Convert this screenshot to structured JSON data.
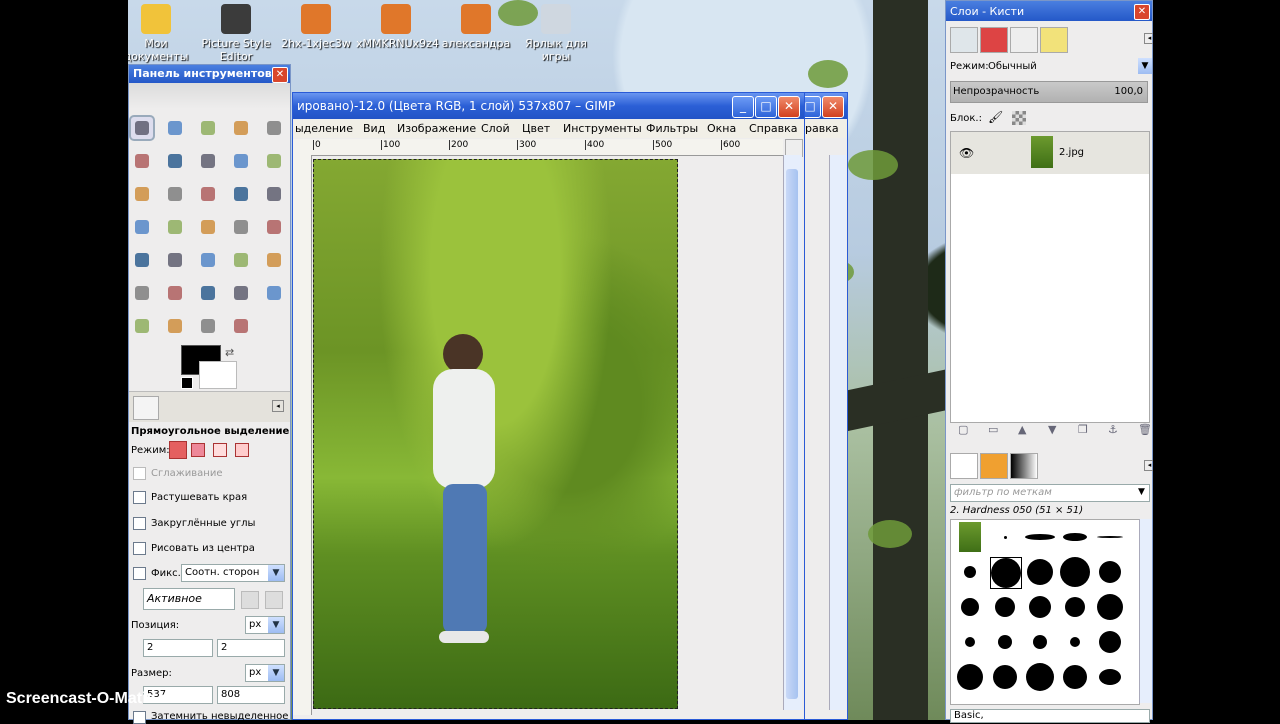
{
  "desktop": {
    "icons": [
      {
        "label": "Мои документы",
        "color": "#f1c33a"
      },
      {
        "label": "Picture Style Editor",
        "color": "#3b3b3b"
      },
      {
        "label": "2hx-1xjec3w",
        "color": "#e0772a"
      },
      {
        "label": "xMMKRNUx9z4",
        "color": "#e0772a"
      },
      {
        "label": "александра",
        "color": "#e0772a"
      },
      {
        "label": "Ярлык для игры",
        "color": "#cfd7e0"
      }
    ]
  },
  "toolbox": {
    "title": "Панель инструментов ...",
    "tool_icons": [
      "rect-select-icon",
      "ellipse-select-icon",
      "free-select-icon",
      "fuzzy-select-icon",
      "color-select-icon",
      "scissors-select-icon",
      "foreground-select-icon",
      "paths-icon",
      "color-picker-icon",
      "zoom-icon",
      "measure-icon",
      "move-icon",
      "align-icon",
      "crop-icon",
      "rotate-icon",
      "scale-icon",
      "shear-icon",
      "perspective-icon",
      "flip-icon",
      "cage-icon",
      "text-icon",
      "bucket-fill-icon",
      "blend-icon",
      "pencil-icon",
      "paintbrush-icon",
      "eraser-icon",
      "airbrush-icon",
      "ink-icon",
      "clone-icon",
      "heal-icon",
      "perspective-clone-icon",
      "blur-icon",
      "smudge-icon",
      "dodge-burn-icon"
    ],
    "fg_color": "#000000",
    "bg_color": "#ffffff",
    "options_title": "Прямоугольное выделение",
    "mode_label": "Режим:",
    "antialias_label": "Сглаживание",
    "feather_label": "Растушевать края",
    "rounded_label": "Закруглённые углы",
    "center_label": "Рисовать из центра",
    "fixed_label": "Фикс.:",
    "fixed_value": "Соотн. сторон",
    "active_value": "Активное",
    "position_label": "Позиция:",
    "position_unit": "px",
    "position_x": "2",
    "position_y": "2",
    "size_label": "Размер:",
    "size_unit": "px",
    "size_w": "537",
    "size_h": "808",
    "darken_label": "Затемнить невыделенное"
  },
  "image_window": {
    "title": "ировано)-12.0 (Цвета RGB, 1 слой) 537x807 – GIMP",
    "menu": [
      "ыделение",
      "Вид",
      "Изображение",
      "Слой",
      "Цвет",
      "Инструменты",
      "Фильтры",
      "Окна",
      "Справка"
    ],
    "menu_extra": "равка",
    "ruler_ticks": [
      "0",
      "100",
      "200",
      "300",
      "400",
      "500",
      "600"
    ]
  },
  "layers": {
    "title": "Слои - Кисти",
    "mode_label": "Режим:",
    "mode_value": "Обычный",
    "opacity_label": "Непрозрачность",
    "opacity_value": "100,0",
    "lock_label": "Блок.:",
    "layer_name": "2.jpg",
    "filter_placeholder": "фильтр по меткам",
    "brush_name": "2. Hardness 050 (51 × 51)",
    "brush_set": "Basic,"
  },
  "watermark": "Screencast-O-Matic.com"
}
